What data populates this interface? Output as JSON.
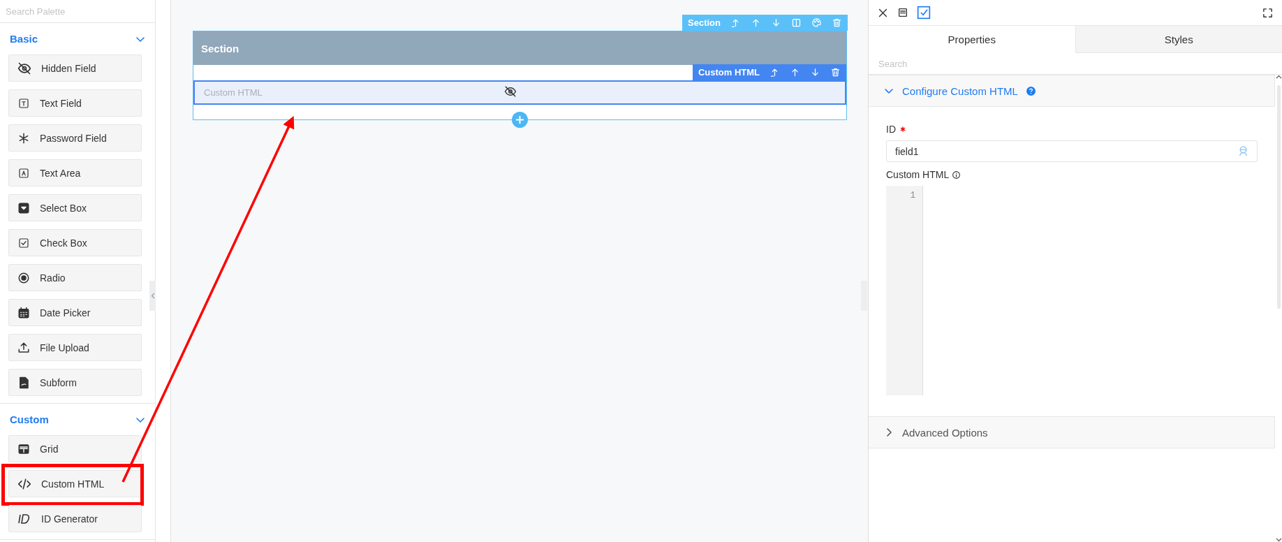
{
  "palette": {
    "search": {
      "placeholder": "Search Palette"
    },
    "groups": [
      {
        "title": "Basic",
        "expanded": true,
        "items": [
          {
            "label": "Hidden Field",
            "highlighted": false
          },
          {
            "label": "Text Field",
            "highlighted": false
          },
          {
            "label": "Password Field",
            "highlighted": false
          },
          {
            "label": "Text Area",
            "highlighted": false
          },
          {
            "label": "Select Box",
            "highlighted": false
          },
          {
            "label": "Check Box",
            "highlighted": false
          },
          {
            "label": "Radio",
            "highlighted": false
          },
          {
            "label": "Date Picker",
            "highlighted": false
          },
          {
            "label": "File Upload",
            "highlighted": false
          },
          {
            "label": "Subform",
            "highlighted": false
          }
        ]
      },
      {
        "title": "Custom",
        "expanded": true,
        "items": [
          {
            "label": "Grid",
            "highlighted": false
          },
          {
            "label": "Custom HTML",
            "highlighted": true
          },
          {
            "label": "ID Generator",
            "highlighted": false
          }
        ]
      }
    ]
  },
  "canvas": {
    "section": {
      "toolbar_label": "Section",
      "title": "Section",
      "components": [
        {
          "toolbar_label": "Custom HTML",
          "label": "Custom HTML",
          "hidden": true
        }
      ]
    }
  },
  "properties_panel": {
    "tabs": [
      {
        "label": "Properties",
        "selected": true
      },
      {
        "label": "Styles",
        "selected": false
      }
    ],
    "search": {
      "placeholder": "Search"
    },
    "sections": [
      {
        "title": "Configure Custom HTML",
        "expanded": true,
        "fields": [
          {
            "kind": "text",
            "label": "ID",
            "required": true,
            "value": "field1"
          },
          {
            "kind": "code",
            "label": "Custom HTML",
            "required": false,
            "line_numbers": [
              "1"
            ]
          }
        ]
      },
      {
        "title": "Advanced Options",
        "expanded": false
      }
    ]
  }
}
